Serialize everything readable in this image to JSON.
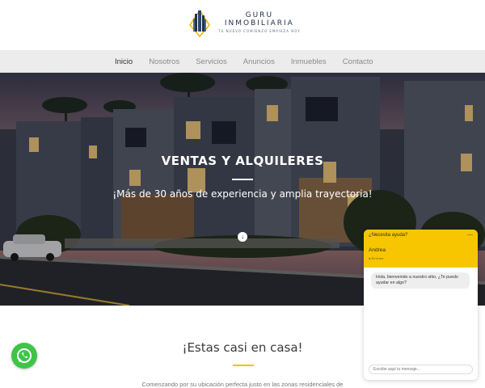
{
  "logo": {
    "line1": "GURU",
    "line2": "INMOBILIARIA",
    "tagline": "TU NUEVO COMIENZO EMPIEZA HOY"
  },
  "nav": {
    "items": [
      {
        "label": "Inicio",
        "active": true
      },
      {
        "label": "Nosotros",
        "active": false
      },
      {
        "label": "Servicios",
        "active": false
      },
      {
        "label": "Anuncios",
        "active": false
      },
      {
        "label": "Inmuebles",
        "active": false
      },
      {
        "label": "Contacto",
        "active": false
      }
    ]
  },
  "hero": {
    "title": "VENTAS Y ALQUILERES",
    "subtitle": "¡Más de 30 años de experiencia y amplia trayectoria!",
    "scroll_icon": "arrow-down-circle-icon"
  },
  "section": {
    "title": "¡Estas casi en casa!",
    "text": "Comenzando por su ubicación perfecta justo en las zonas residenciales de"
  },
  "whatsapp": {
    "icon": "whatsapp-icon",
    "color": "#3ec447"
  },
  "chat": {
    "header_question": "¿Necesita ayuda?",
    "close_icon": "close-icon",
    "agent_name": "Andrea",
    "agent_status": "● En línea",
    "message": "Hola, bienvenido a nuestro sitio, ¿Te puedo ayudar en algo?",
    "input_placeholder": "Escribe aquí tu mensaje..."
  },
  "colors": {
    "accent": "#f7c600",
    "nav_bg": "#ececec",
    "logo_navy": "#22324a",
    "whatsapp": "#3ec447"
  }
}
